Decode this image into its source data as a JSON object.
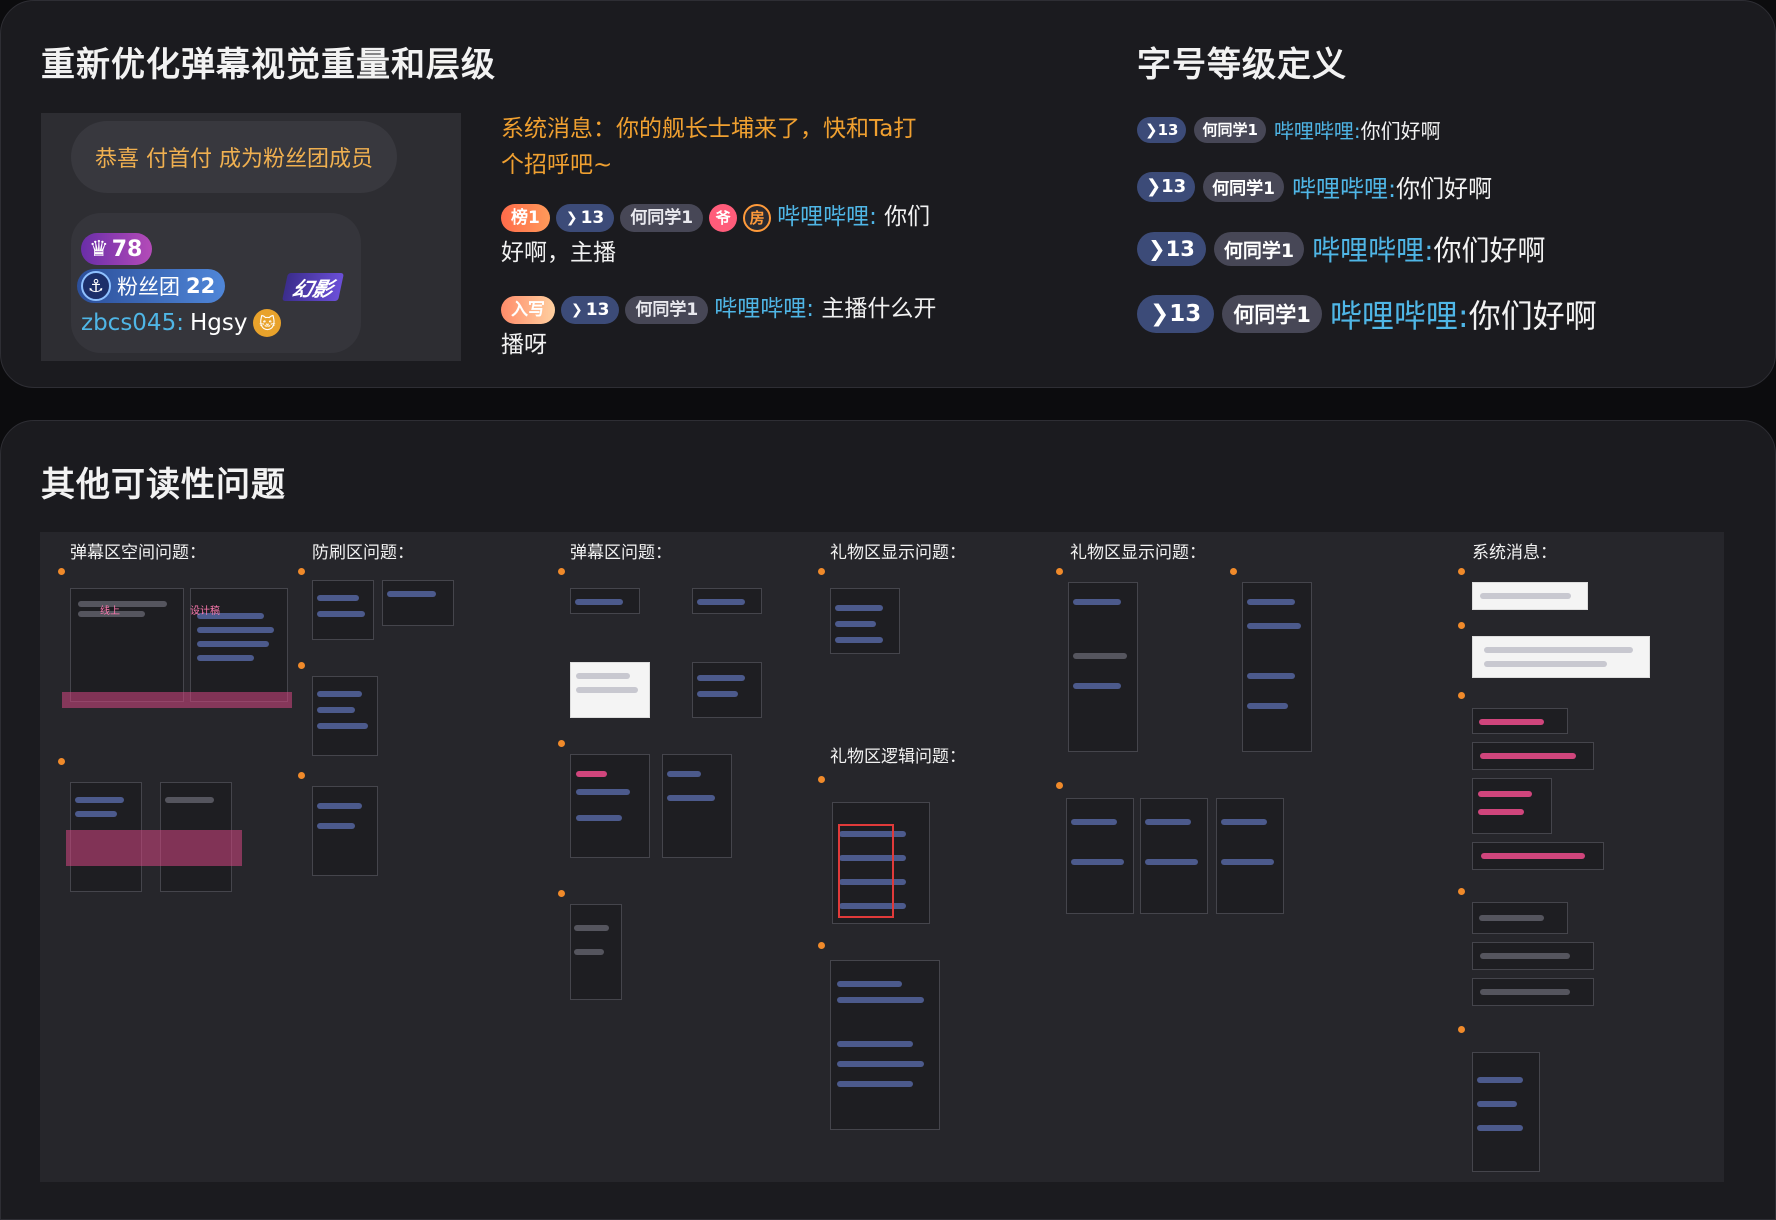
{
  "section1": {
    "title": "重新优化弹幕视觉重量和层级",
    "demo": {
      "congrats": "恭喜 付首付 成为粉丝团成员",
      "level": "78",
      "fans_label": "粉丝团",
      "fans_level": "22",
      "phantom": "幻影",
      "username": "zbcs045:",
      "message": "Hgsy"
    },
    "system_message": "系统消息：你的舰长士埔来了，快和Ta打个招呼吧~",
    "messages": [
      {
        "badges": [
          "榜1",
          "13",
          "何同学1"
        ],
        "circles": [
          "爷",
          "房"
        ],
        "name": "哔哩哔哩:",
        "text": "你们好啊，主播"
      },
      {
        "badges": [
          "入写",
          "13",
          "何同学1"
        ],
        "name": "哔哩哔哩:",
        "text": "主播什么开播呀"
      }
    ]
  },
  "fontsize": {
    "title": "字号等级定义",
    "rows": [
      {
        "level": "13",
        "user": "何同学1",
        "name": "哔哩哔哩:",
        "text": "你们好啊"
      },
      {
        "level": "13",
        "user": "何同学1",
        "name": "哔哩哔哩:",
        "text": "你们好啊"
      },
      {
        "level": "13",
        "user": "何同学1",
        "name": "哔哩哔哩:",
        "text": "你们好啊"
      },
      {
        "level": "13",
        "user": "何同学1",
        "name": "哔哩哔哩:",
        "text": "你们好啊"
      }
    ]
  },
  "section2": {
    "title": "其他可读性问题",
    "columns": [
      {
        "title": "弹幕区空间问题："
      },
      {
        "title": "防刷区问题："
      },
      {
        "title": "弹幕区问题："
      },
      {
        "title": "礼物区显示问题："
      },
      {
        "title": "礼物区显示问题："
      },
      {
        "title": "系统消息："
      }
    ],
    "gift_logic_title": "礼物区逻辑问题：",
    "thumb_labels": {
      "online": "线上",
      "design": "设计稿"
    }
  },
  "colors": {
    "accent_orange": "#f0a030",
    "bili_blue": "#4fb6e6",
    "level_badge": "#3c4b78",
    "user_badge": "#474756",
    "highlight_pink": "#d4467e"
  }
}
